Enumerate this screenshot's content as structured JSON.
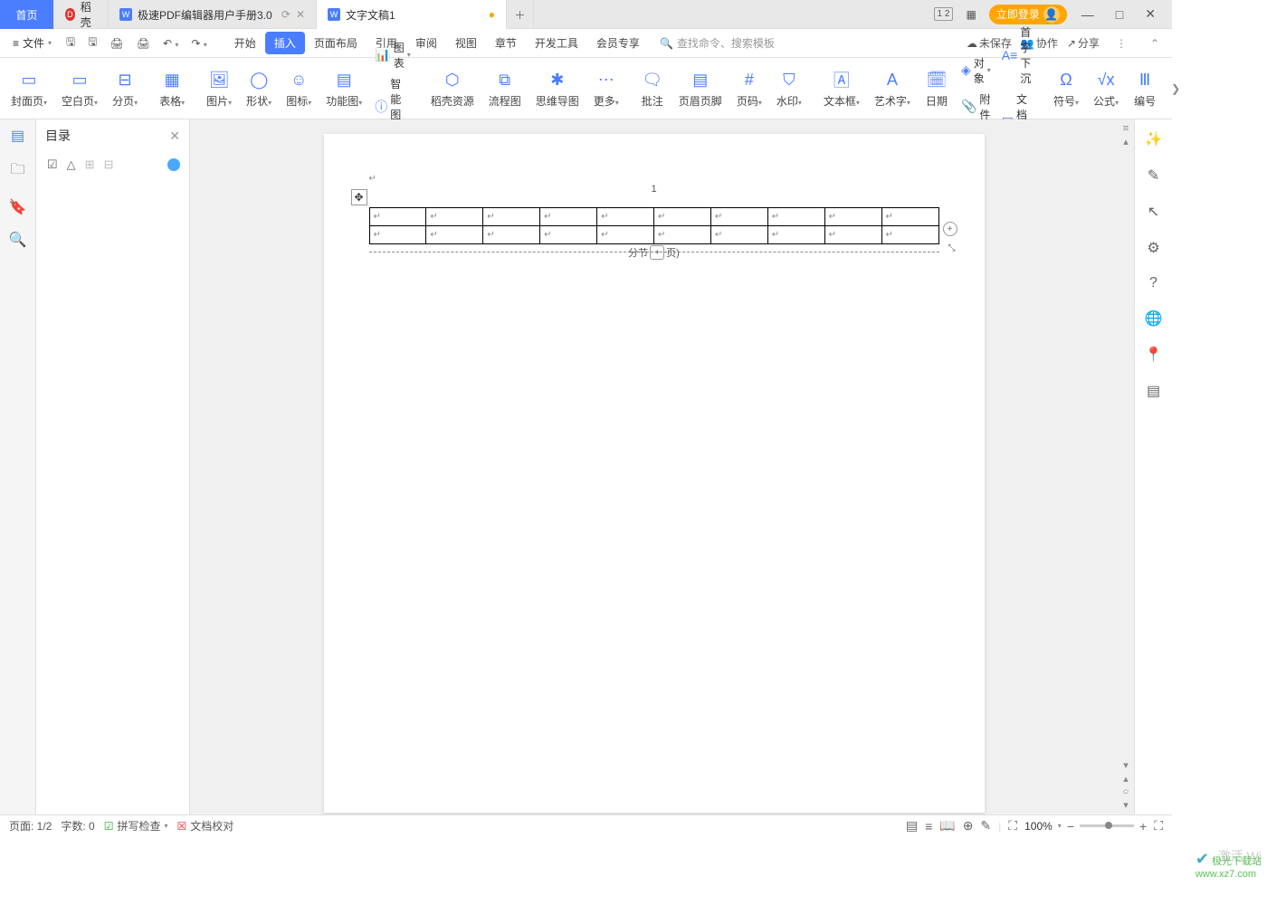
{
  "titlebar": {
    "home": "首页",
    "docer": "稻壳",
    "tab_pdf": "极速PDF编辑器用户手册3.0",
    "tab_active": "文字文稿1",
    "login": "立即登录"
  },
  "menubar": {
    "file": "文件",
    "tabs": [
      "开始",
      "插入",
      "页面布局",
      "引用",
      "审阅",
      "视图",
      "章节",
      "开发工具",
      "会员专享"
    ],
    "active_tab_index": 1,
    "search_placeholder": "查找命令、搜索模板",
    "unsaved": "未保存",
    "collab": "协作",
    "share": "分享"
  },
  "ribbon": {
    "cover": "封面页",
    "blank": "空白页",
    "pagebreak": "分页",
    "table": "表格",
    "picture": "图片",
    "shape": "形状",
    "iconlib": "图标",
    "featured": "功能图",
    "chart": "图表",
    "smartart": "智能图形",
    "resources": "稻壳资源",
    "flowchart": "流程图",
    "mindmap": "思维导图",
    "more": "更多",
    "comment": "批注",
    "headerfooter": "页眉页脚",
    "pageno": "页码",
    "watermark": "水印",
    "textbox": "文本框",
    "wordart": "艺术字",
    "date": "日期",
    "object": "对象",
    "dropcap": "首字下沉",
    "attach": "附件",
    "docpart": "文档部件",
    "symbol": "符号",
    "equation": "公式",
    "number": "编号"
  },
  "panel": {
    "title": "目录"
  },
  "page": {
    "number": "1",
    "cell_mark": "↵",
    "table_rows": 2,
    "table_cols": 10,
    "section_break_left": "分节",
    "section_break_right": "页)"
  },
  "status": {
    "page": "页面: 1/2",
    "words": "字数: 0",
    "spell": "拼写检查",
    "proof": "文档校对",
    "zoom": "100%"
  },
  "watermark": {
    "line1": "www.xz7.com",
    "line2": "激活 Wi"
  }
}
